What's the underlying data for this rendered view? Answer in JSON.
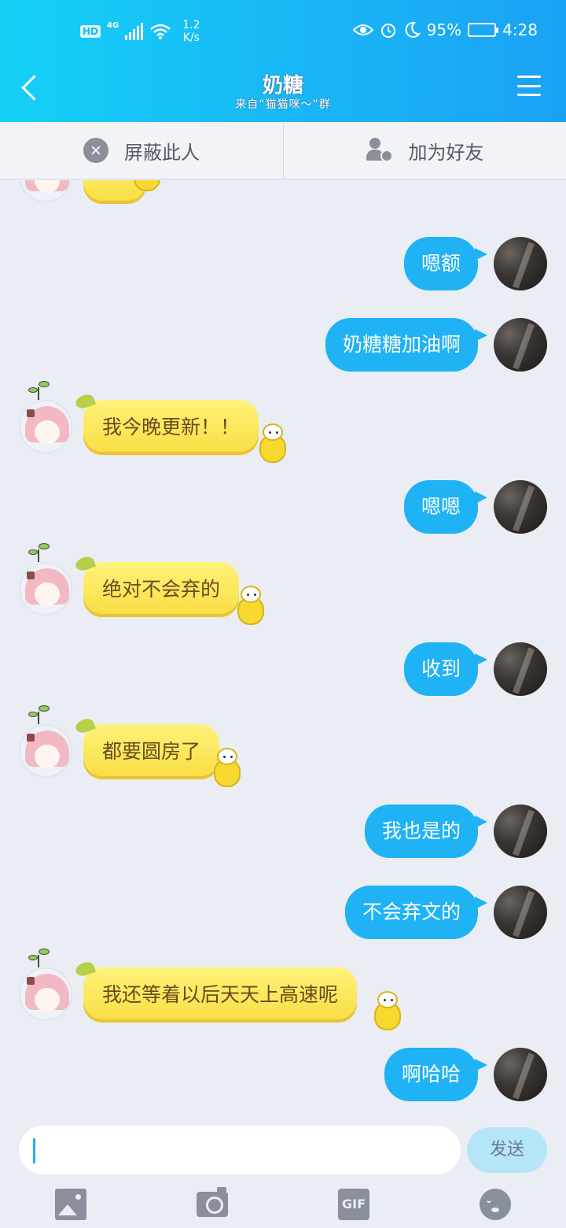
{
  "status_bar": {
    "hd": "HD",
    "network": "4G",
    "speed_value": "1.2",
    "speed_unit": "K/s",
    "battery": "95%",
    "battery_level": 0.95,
    "time": "4:28"
  },
  "header": {
    "title": "奶糖",
    "subtitle": "来自“猫猫咪～”群"
  },
  "actions": {
    "block": "屏蔽此人",
    "add_friend": "加为好友"
  },
  "messages": [
    {
      "side": "right",
      "text": "嗯额"
    },
    {
      "side": "right",
      "text": "奶糖糖加油啊"
    },
    {
      "side": "left",
      "text": "我今晚更新！！"
    },
    {
      "side": "right",
      "text": "嗯嗯"
    },
    {
      "side": "left",
      "text": "绝对不会弃的"
    },
    {
      "side": "right",
      "text": "收到"
    },
    {
      "side": "left",
      "text": "都要圆房了"
    },
    {
      "side": "right",
      "text": "我也是的"
    },
    {
      "side": "right",
      "text": "不会弃文的"
    },
    {
      "side": "left",
      "text": "我还等着以后天天上高速呢"
    },
    {
      "side": "right",
      "text": "啊哈哈"
    }
  ],
  "input": {
    "value": "",
    "send": "发送"
  },
  "toolbar": {
    "gif": "GIF"
  },
  "colors": {
    "accent": "#1fb2f4",
    "header_start": "#14d0f5",
    "header_end": "#1aa2f3",
    "bubble_yellow": "#f9dd42",
    "background": "#eaedf4"
  }
}
